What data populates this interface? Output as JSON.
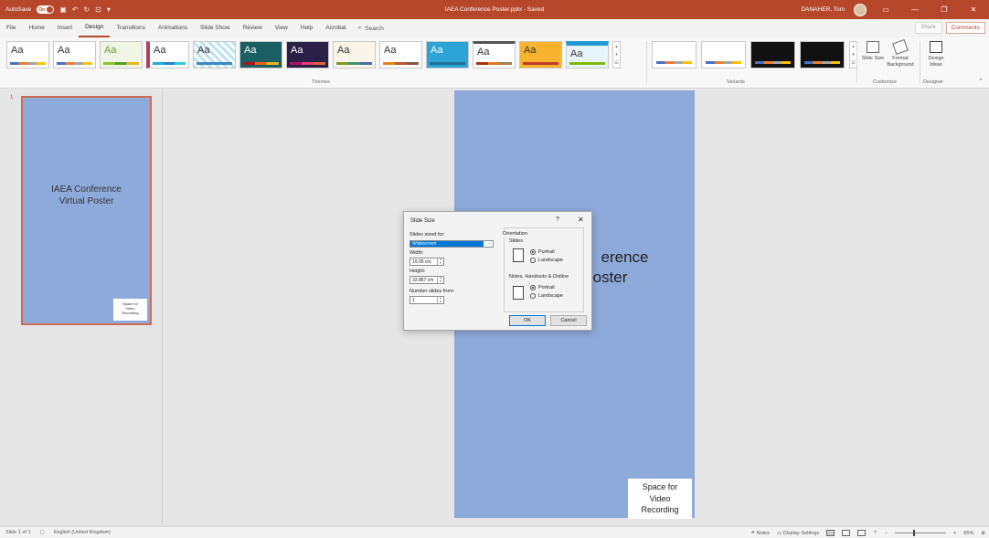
{
  "titlebar": {
    "autosave_label": "AutoSave",
    "autosave_state": "On",
    "document_title": "IAEA Conference Poster.pptx - Saved",
    "user": "DANAHER, Tom",
    "accent": "#b7472a"
  },
  "menu": {
    "tabs": [
      "File",
      "Home",
      "Insert",
      "Design",
      "Transitions",
      "Animations",
      "Slide Show",
      "Review",
      "View",
      "Help",
      "Acrobat"
    ],
    "active": "Design",
    "search_label": "Search",
    "share_label": "Share",
    "comments_label": "Comments"
  },
  "ribbon": {
    "theme_sample": "Aa",
    "themes_label": "Themes",
    "variants_label": "Variants",
    "customize_label": "Customize",
    "designer_label": "Designer",
    "slide_size_label": "Slide Size",
    "format_background_label": "Format Background",
    "design_ideas_label": "Design Ideas"
  },
  "thumbnail": {
    "number": "1",
    "title_line1": "IAEA Conference",
    "title_line2": "Virtual Poster",
    "box_line1": "Space for",
    "box_line2": "Video",
    "box_line3": "Recording"
  },
  "slide": {
    "title_line1": "erence",
    "title_line2": "oster",
    "box_line1": "Space for",
    "box_line2": "Video",
    "box_line3": "Recording",
    "background": "#8eaadb"
  },
  "dialog": {
    "title": "Slide Size",
    "help": "?",
    "close": "✕",
    "slides_sized_for_label": "Slides sized for:",
    "slides_sized_for_value": "Widescreen",
    "width_label": "Width:",
    "width_value": "19.05 cm",
    "height_label": "Height:",
    "height_value": "33.867 cm",
    "number_from_label": "Number slides from:",
    "number_from_value": "1",
    "orientation_label": "Orientation",
    "slides_label": "Slides",
    "portrait_label": "Portrait",
    "landscape_label": "Landscape",
    "notes_label": "Notes, Handouts & Outline",
    "ok_label": "OK",
    "cancel_label": "Cancel"
  },
  "statusbar": {
    "slide_count": "Slide 1 of 1",
    "language": "English (United Kingdom)",
    "notes_label": "Notes",
    "display_settings_label": "Display Settings",
    "zoom": "65%"
  }
}
